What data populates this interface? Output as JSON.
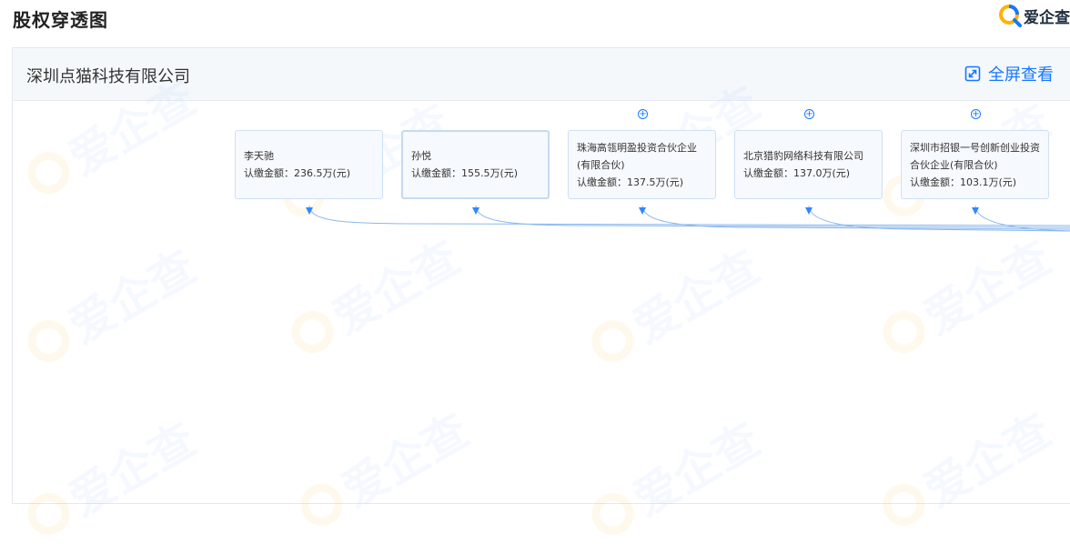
{
  "header": {
    "title": "股权穿透图",
    "brand": "爱企查"
  },
  "panel": {
    "company_name": "深圳点猫科技有限公司",
    "fullscreen_label": "全屏查看"
  },
  "watermark_text": "爱企查",
  "shareholders": [
    {
      "name": "李天驰",
      "amount_label": "认缴金额：",
      "amount": "236.5万(元)",
      "expandable": false
    },
    {
      "name": "孙悦",
      "amount_label": "认缴金额：",
      "amount": "155.5万(元)",
      "expandable": false
    },
    {
      "name": "珠海高瓴明盈投资合伙企业(有限合伙)",
      "amount_label": "认缴金额：",
      "amount": "137.5万(元)",
      "expandable": true
    },
    {
      "name": "北京猎豹网络科技有限公司",
      "amount_label": "认缴金额：",
      "amount": "137.0万(元)",
      "expandable": true
    },
    {
      "name": "深圳市招银一号创新创业投资合伙企业(有限合伙)",
      "amount_label": "认缴金额：",
      "amount": "103.1万(元)",
      "expandable": true
    }
  ],
  "colors": {
    "accent": "#1677ff",
    "connector": "#8cb8ee",
    "arrow": "#2f88ff"
  }
}
